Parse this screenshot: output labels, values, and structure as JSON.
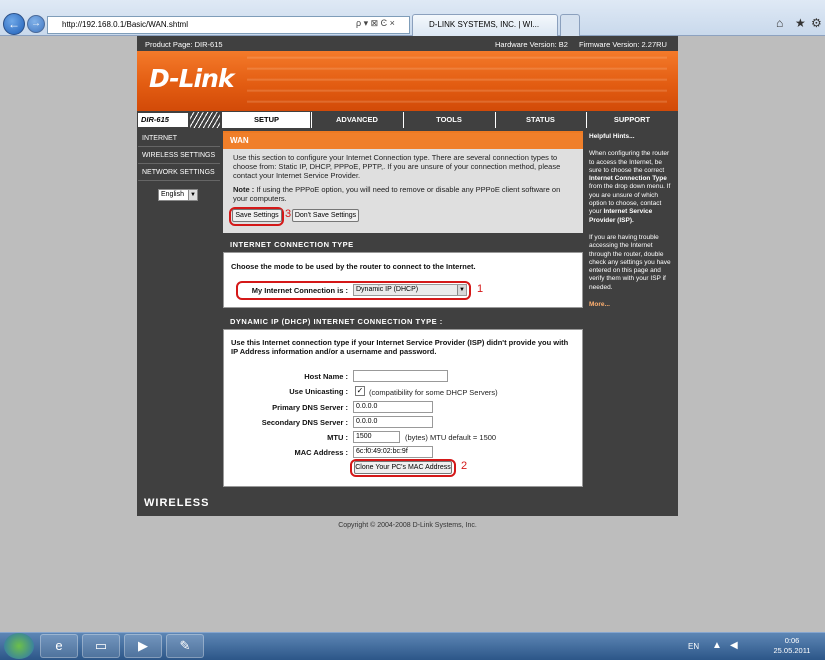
{
  "browser": {
    "url": "http://192.168.0.1/Basic/WAN.shtml",
    "search_glyph": "ρ ▾ ⊠ Ͼ ×",
    "tab_title": "D-LINK SYSTEMS, INC. | WI..."
  },
  "header": {
    "product_page": "Product Page: DIR-615",
    "hardware": "Hardware Version: B2",
    "firmware": "Firmware Version: 2.27RU",
    "logo": "D-Link"
  },
  "model": "DIR-615",
  "tabs": [
    "SETUP",
    "ADVANCED",
    "TOOLS",
    "STATUS",
    "SUPPORT"
  ],
  "leftnav": [
    "INTERNET",
    "WIRELESS SETTINGS",
    "NETWORK SETTINGS"
  ],
  "language": "English",
  "wan": {
    "title": "WAN",
    "intro": "Use this section to configure your Internet Connection type. There are several connection types to choose from: Static IP, DHCP, PPPoE, PPTP,. If you are unsure of your connection method, please contact your Internet Service Provider.",
    "note_label": "Note :",
    "note": "If using the PPPoE option, you will need to remove or disable any PPPoE client software on your computers.",
    "save": "Save Settings",
    "dont_save": "Don't Save Settings",
    "marker": "3"
  },
  "ict": {
    "title": "INTERNET CONNECTION TYPE",
    "prompt": "Choose the mode to be used by the router to connect to the Internet.",
    "label": "My Internet Connection is :",
    "value": "Dynamic IP (DHCP)",
    "marker": "1"
  },
  "dhcp": {
    "title": "DYNAMIC IP (DHCP) INTERNET CONNECTION TYPE :",
    "desc": "Use this Internet connection type if your Internet Service Provider (ISP) didn't provide you with IP Address information and/or a username and password.",
    "host_label": "Host Name :",
    "host_value": "",
    "unicast_label": "Use Unicasting :",
    "unicast_note": "(compatibility for some DHCP Servers)",
    "dns1_label": "Primary DNS Server :",
    "dns1": "0.0.0.0",
    "dns2_label": "Secondary DNS Server :",
    "dns2": "0.0.0.0",
    "mtu_label": "MTU :",
    "mtu": "1500",
    "mtu_note": "(bytes) MTU default = 1500",
    "mac_label": "MAC Address :",
    "mac": "6c:f0:49:02:bc:9f",
    "clone": "Clone Your PC's MAC Address",
    "marker": "2"
  },
  "hints": {
    "title": "Helpful Hints...",
    "p1a": "When configuring the router to access the Internet, be sure to choose the correct ",
    "p1b": "Internet Connection Type",
    "p1c": " from the drop down menu. If you are unsure of which option to choose, contact your ",
    "p1d": "Internet Service Provider (ISP).",
    "p2": "If you are having trouble accessing the Internet through the router, double check any settings you have entered on this page and verify them with your ISP if needed.",
    "more": "More..."
  },
  "footer": {
    "brand": "WIRELESS",
    "copyright": "Copyright © 2004-2008 D-Link Systems, Inc."
  },
  "taskbar": {
    "lang": "EN",
    "time": "0:06",
    "date": "25.05.2011"
  }
}
